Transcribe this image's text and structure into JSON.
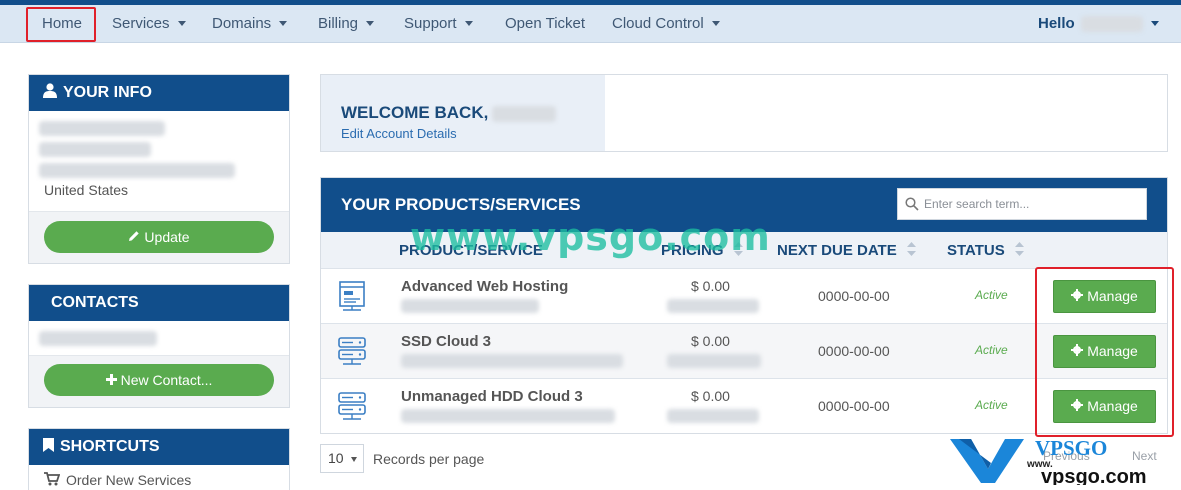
{
  "nav": {
    "home": "Home",
    "services": "Services",
    "domains": "Domains",
    "billing": "Billing",
    "support": "Support",
    "open_ticket": "Open Ticket",
    "cloud_control": "Cloud Control",
    "user_greeting": "Hello"
  },
  "your_info": {
    "title": "YOUR INFO",
    "country": "United States",
    "update_label": "Update"
  },
  "contacts": {
    "title": "CONTACTS",
    "new_contact_label": "New Contact..."
  },
  "shortcuts": {
    "title": "SHORTCUTS",
    "items": [
      "Order New Services"
    ]
  },
  "welcome": {
    "title": "WELCOME BACK,",
    "edit_link": "Edit Account Details"
  },
  "products": {
    "title": "YOUR PRODUCTS/SERVICES",
    "search_placeholder": "Enter search term...",
    "columns": [
      "PRODUCT/SERVICE",
      "PRICING",
      "NEXT DUE DATE",
      "STATUS"
    ],
    "rows": [
      {
        "name": "Advanced Web Hosting",
        "price": "$ 0.00",
        "due": "0000-00-00",
        "status": "Active",
        "action": "Manage",
        "icon": "web-hosting-icon"
      },
      {
        "name": "SSD Cloud 3",
        "price": "$ 0.00",
        "due": "0000-00-00",
        "status": "Active",
        "action": "Manage",
        "icon": "server-icon"
      },
      {
        "name": "Unmanaged HDD Cloud 3",
        "price": "$ 0.00",
        "due": "0000-00-00",
        "status": "Active",
        "action": "Manage",
        "icon": "server-icon"
      }
    ],
    "records_per_page_value": "10",
    "records_per_page_label": "Records per page",
    "pagination": {
      "previous": "Previous",
      "next": "Next"
    }
  },
  "watermark": "www.vpsgo.com",
  "logo": {
    "letters": "VPSGO",
    "url": "vpsgo.com",
    "www": "www."
  },
  "colors": {
    "brand": "#114e8b",
    "nav_bg": "#dbe7f3",
    "accent_green": "#5aab4f",
    "highlight_red": "#e0202a",
    "watermark": "#1cbea0"
  }
}
